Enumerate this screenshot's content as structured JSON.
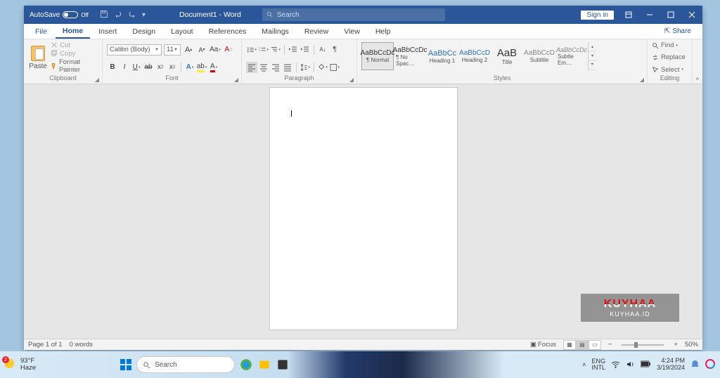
{
  "titlebar": {
    "autosave": "AutoSave",
    "autosave_state": "Off",
    "doc_title": "Document1 - Word",
    "search_placeholder": "Search",
    "signin": "Sign in"
  },
  "tabs": {
    "file": "File",
    "home": "Home",
    "insert": "Insert",
    "design": "Design",
    "layout": "Layout",
    "references": "References",
    "mailings": "Mailings",
    "review": "Review",
    "view": "View",
    "help": "Help",
    "share": "Share"
  },
  "ribbon": {
    "clipboard": {
      "label": "Clipboard",
      "paste": "Paste",
      "cut": "Cut",
      "copy": "Copy",
      "format_painter": "Format Painter"
    },
    "font": {
      "label": "Font",
      "name": "Calibri (Body)",
      "size": "11",
      "grow": "A",
      "shrink": "A",
      "case": "Aa",
      "clear": "A"
    },
    "paragraph": {
      "label": "Paragraph"
    },
    "styles": {
      "label": "Styles",
      "items": [
        {
          "sample": "AaBbCcDc",
          "name": "¶ Normal"
        },
        {
          "sample": "AaBbCcDc",
          "name": "¶ No Spac…"
        },
        {
          "sample": "AaBbCc",
          "name": "Heading 1"
        },
        {
          "sample": "AaBbCcD",
          "name": "Heading 2"
        },
        {
          "sample": "AaB",
          "name": "Title"
        },
        {
          "sample": "AaBbCcD",
          "name": "Subtitle"
        },
        {
          "sample": "AaBbCcDc",
          "name": "Subtle Em…"
        }
      ]
    },
    "editing": {
      "label": "Editing",
      "find": "Find",
      "replace": "Replace",
      "select": "Select"
    }
  },
  "statusbar": {
    "page": "Page 1 of 1",
    "words": "0 words",
    "focus": "Focus",
    "zoom": "50%"
  },
  "taskbar": {
    "temp": "93°F",
    "cond": "Haze",
    "badge": "2",
    "search_placeholder": "Search",
    "lang1": "ENG",
    "lang2": "INTL",
    "time": "4:24 PM",
    "date": "3/19/2024"
  },
  "watermark": {
    "name": "KUYHAA",
    "url": "KUYHAA.ID"
  }
}
